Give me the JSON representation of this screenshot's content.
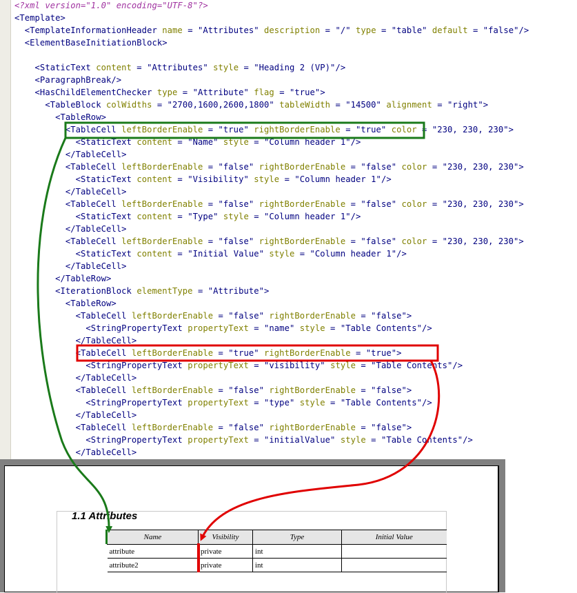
{
  "editor": {
    "lines": [
      [
        [
          "p",
          "<?xml version=\"1.0\" encoding=\"UTF-8\"?>"
        ]
      ],
      [
        [
          "t",
          "<Template>"
        ]
      ],
      [
        [
          "t",
          "  <TemplateInformationHeader "
        ],
        [
          "a",
          "name"
        ],
        [
          "t",
          " = "
        ],
        [
          "v",
          "\"Attributes\""
        ],
        [
          "t",
          " "
        ],
        [
          "a",
          "description"
        ],
        [
          "t",
          " = "
        ],
        [
          "v",
          "\"/\""
        ],
        [
          "t",
          " "
        ],
        [
          "a",
          "type"
        ],
        [
          "t",
          " = "
        ],
        [
          "v",
          "\"table\""
        ],
        [
          "t",
          " "
        ],
        [
          "a",
          "default"
        ],
        [
          "t",
          " = "
        ],
        [
          "v",
          "\"false\""
        ],
        [
          "t",
          "/>"
        ]
      ],
      [
        [
          "t",
          "  <ElementBaseInitiationBlock>"
        ]
      ],
      [],
      [
        [
          "t",
          "    <StaticText "
        ],
        [
          "a",
          "content"
        ],
        [
          "t",
          " = "
        ],
        [
          "v",
          "\"Attributes\""
        ],
        [
          "t",
          " "
        ],
        [
          "a",
          "style"
        ],
        [
          "t",
          " = "
        ],
        [
          "v",
          "\"Heading 2 (VP)\""
        ],
        [
          "t",
          "/>"
        ]
      ],
      [
        [
          "t",
          "    <ParagraphBreak/>"
        ]
      ],
      [
        [
          "t",
          "    <HasChildElementChecker "
        ],
        [
          "a",
          "type"
        ],
        [
          "t",
          " = "
        ],
        [
          "v",
          "\"Attribute\""
        ],
        [
          "t",
          " "
        ],
        [
          "a",
          "flag"
        ],
        [
          "t",
          " = "
        ],
        [
          "v",
          "\"true\""
        ],
        [
          "t",
          ">"
        ]
      ],
      [
        [
          "t",
          "      <TableBlock "
        ],
        [
          "a",
          "colWidths"
        ],
        [
          "t",
          " = "
        ],
        [
          "v",
          "\"2700,1600,2600,1800\""
        ],
        [
          "t",
          " "
        ],
        [
          "a",
          "tableWidth"
        ],
        [
          "t",
          " = "
        ],
        [
          "v",
          "\"14500\""
        ],
        [
          "t",
          " "
        ],
        [
          "a",
          "alignment"
        ],
        [
          "t",
          " = "
        ],
        [
          "v",
          "\"right\""
        ],
        [
          "t",
          ">"
        ]
      ],
      [
        [
          "t",
          "        <TableRow>"
        ]
      ],
      [
        [
          "t",
          "          <TableCell "
        ],
        [
          "a",
          "leftBorderEnable"
        ],
        [
          "t",
          " = "
        ],
        [
          "v",
          "\"true\""
        ],
        [
          "t",
          " "
        ],
        [
          "a",
          "rightBorderEnable"
        ],
        [
          "t",
          " = "
        ],
        [
          "v",
          "\"true\""
        ],
        [
          "t",
          " "
        ],
        [
          "a",
          "color"
        ],
        [
          "t",
          " = "
        ],
        [
          "v",
          "\"230, 230, 230\""
        ],
        [
          "t",
          ">"
        ]
      ],
      [
        [
          "t",
          "            <StaticText "
        ],
        [
          "a",
          "content"
        ],
        [
          "t",
          " = "
        ],
        [
          "v",
          "\"Name\""
        ],
        [
          "t",
          " "
        ],
        [
          "a",
          "style"
        ],
        [
          "t",
          " = "
        ],
        [
          "v",
          "\"Column header 1\""
        ],
        [
          "t",
          "/>"
        ]
      ],
      [
        [
          "t",
          "          </TableCell>"
        ]
      ],
      [
        [
          "t",
          "          <TableCell "
        ],
        [
          "a",
          "leftBorderEnable"
        ],
        [
          "t",
          " = "
        ],
        [
          "v",
          "\"false\""
        ],
        [
          "t",
          " "
        ],
        [
          "a",
          "rightBorderEnable"
        ],
        [
          "t",
          " = "
        ],
        [
          "v",
          "\"false\""
        ],
        [
          "t",
          " "
        ],
        [
          "a",
          "color"
        ],
        [
          "t",
          " = "
        ],
        [
          "v",
          "\"230, 230, 230\""
        ],
        [
          "t",
          ">"
        ]
      ],
      [
        [
          "t",
          "            <StaticText "
        ],
        [
          "a",
          "content"
        ],
        [
          "t",
          " = "
        ],
        [
          "v",
          "\"Visibility\""
        ],
        [
          "t",
          " "
        ],
        [
          "a",
          "style"
        ],
        [
          "t",
          " = "
        ],
        [
          "v",
          "\"Column header 1\""
        ],
        [
          "t",
          "/>"
        ]
      ],
      [
        [
          "t",
          "          </TableCell>"
        ]
      ],
      [
        [
          "t",
          "          <TableCell "
        ],
        [
          "a",
          "leftBorderEnable"
        ],
        [
          "t",
          " = "
        ],
        [
          "v",
          "\"false\""
        ],
        [
          "t",
          " "
        ],
        [
          "a",
          "rightBorderEnable"
        ],
        [
          "t",
          " = "
        ],
        [
          "v",
          "\"false\""
        ],
        [
          "t",
          " "
        ],
        [
          "a",
          "color"
        ],
        [
          "t",
          " = "
        ],
        [
          "v",
          "\"230, 230, 230\""
        ],
        [
          "t",
          ">"
        ]
      ],
      [
        [
          "t",
          "            <StaticText "
        ],
        [
          "a",
          "content"
        ],
        [
          "t",
          " = "
        ],
        [
          "v",
          "\"Type\""
        ],
        [
          "t",
          " "
        ],
        [
          "a",
          "style"
        ],
        [
          "t",
          " = "
        ],
        [
          "v",
          "\"Column header 1\""
        ],
        [
          "t",
          "/>"
        ]
      ],
      [
        [
          "t",
          "          </TableCell>"
        ]
      ],
      [
        [
          "t",
          "          <TableCell "
        ],
        [
          "a",
          "leftBorderEnable"
        ],
        [
          "t",
          " = "
        ],
        [
          "v",
          "\"false\""
        ],
        [
          "t",
          " "
        ],
        [
          "a",
          "rightBorderEnable"
        ],
        [
          "t",
          " = "
        ],
        [
          "v",
          "\"false\""
        ],
        [
          "t",
          " "
        ],
        [
          "a",
          "color"
        ],
        [
          "t",
          " = "
        ],
        [
          "v",
          "\"230, 230, 230\""
        ],
        [
          "t",
          ">"
        ]
      ],
      [
        [
          "t",
          "            <StaticText "
        ],
        [
          "a",
          "content"
        ],
        [
          "t",
          " = "
        ],
        [
          "v",
          "\"Initial Value\""
        ],
        [
          "t",
          " "
        ],
        [
          "a",
          "style"
        ],
        [
          "t",
          " = "
        ],
        [
          "v",
          "\"Column header 1\""
        ],
        [
          "t",
          "/>"
        ]
      ],
      [
        [
          "t",
          "          </TableCell>"
        ]
      ],
      [
        [
          "t",
          "        </TableRow>"
        ]
      ],
      [
        [
          "t",
          "        <IterationBlock "
        ],
        [
          "a",
          "elementType"
        ],
        [
          "t",
          " = "
        ],
        [
          "v",
          "\"Attribute\""
        ],
        [
          "t",
          ">"
        ]
      ],
      [
        [
          "t",
          "          <TableRow>"
        ]
      ],
      [
        [
          "t",
          "            <TableCell "
        ],
        [
          "a",
          "leftBorderEnable"
        ],
        [
          "t",
          " = "
        ],
        [
          "v",
          "\"false\""
        ],
        [
          "t",
          " "
        ],
        [
          "a",
          "rightBorderEnable"
        ],
        [
          "t",
          " = "
        ],
        [
          "v",
          "\"false\""
        ],
        [
          "t",
          ">"
        ]
      ],
      [
        [
          "t",
          "              <StringPropertyText "
        ],
        [
          "a",
          "propertyText"
        ],
        [
          "t",
          " = "
        ],
        [
          "v",
          "\"name\""
        ],
        [
          "t",
          " "
        ],
        [
          "a",
          "style"
        ],
        [
          "t",
          " = "
        ],
        [
          "v",
          "\"Table Contents\""
        ],
        [
          "t",
          "/>"
        ]
      ],
      [
        [
          "t",
          "            </TableCell>"
        ]
      ],
      [
        [
          "t",
          "            <TableCell "
        ],
        [
          "a",
          "leftBorderEnable"
        ],
        [
          "t",
          " = "
        ],
        [
          "v",
          "\"true\""
        ],
        [
          "t",
          " "
        ],
        [
          "a",
          "rightBorderEnable"
        ],
        [
          "t",
          " = "
        ],
        [
          "v",
          "\"true\""
        ],
        [
          "t",
          ">"
        ]
      ],
      [
        [
          "t",
          "              <StringPropertyText "
        ],
        [
          "a",
          "propertyText"
        ],
        [
          "t",
          " = "
        ],
        [
          "v",
          "\"visibility\""
        ],
        [
          "t",
          " "
        ],
        [
          "a",
          "style"
        ],
        [
          "t",
          " = "
        ],
        [
          "v",
          "\"Table Contents\""
        ],
        [
          "t",
          "/>"
        ]
      ],
      [
        [
          "t",
          "            </TableCell>"
        ]
      ],
      [
        [
          "t",
          "            <TableCell "
        ],
        [
          "a",
          "leftBorderEnable"
        ],
        [
          "t",
          " = "
        ],
        [
          "v",
          "\"false\""
        ],
        [
          "t",
          " "
        ],
        [
          "a",
          "rightBorderEnable"
        ],
        [
          "t",
          " = "
        ],
        [
          "v",
          "\"false\""
        ],
        [
          "t",
          ">"
        ]
      ],
      [
        [
          "t",
          "              <StringPropertyText "
        ],
        [
          "a",
          "propertyText"
        ],
        [
          "t",
          " = "
        ],
        [
          "v",
          "\"type\""
        ],
        [
          "t",
          " "
        ],
        [
          "a",
          "style"
        ],
        [
          "t",
          " = "
        ],
        [
          "v",
          "\"Table Contents\""
        ],
        [
          "t",
          "/>"
        ]
      ],
      [
        [
          "t",
          "            </TableCell>"
        ]
      ],
      [
        [
          "t",
          "            <TableCell "
        ],
        [
          "a",
          "leftBorderEnable"
        ],
        [
          "t",
          " = "
        ],
        [
          "v",
          "\"false\""
        ],
        [
          "t",
          " "
        ],
        [
          "a",
          "rightBorderEnable"
        ],
        [
          "t",
          " = "
        ],
        [
          "v",
          "\"false\""
        ],
        [
          "t",
          ">"
        ]
      ],
      [
        [
          "t",
          "              <StringPropertyText "
        ],
        [
          "a",
          "propertyText"
        ],
        [
          "t",
          " = "
        ],
        [
          "v",
          "\"initialValue\""
        ],
        [
          "t",
          " "
        ],
        [
          "a",
          "style"
        ],
        [
          "t",
          " = "
        ],
        [
          "v",
          "\"Table Contents\""
        ],
        [
          "t",
          "/>"
        ]
      ],
      [
        [
          "t",
          "            </TableCell>"
        ]
      ]
    ]
  },
  "preview": {
    "heading": "1.1 Attributes",
    "table": {
      "headers": [
        "Name",
        "Visibility",
        "Type",
        "Initial Value"
      ],
      "rows": [
        [
          "attribute",
          "private",
          "int",
          ""
        ],
        [
          "attribute2",
          "private",
          "int",
          ""
        ]
      ]
    }
  },
  "colors": {
    "tag": "#000080",
    "attribute": "#808000",
    "prolog": "#a032a0",
    "header_highlight": "#1a7a1a",
    "row_highlight": "#e00000",
    "header_cell_fill": "#e6e6e6"
  }
}
